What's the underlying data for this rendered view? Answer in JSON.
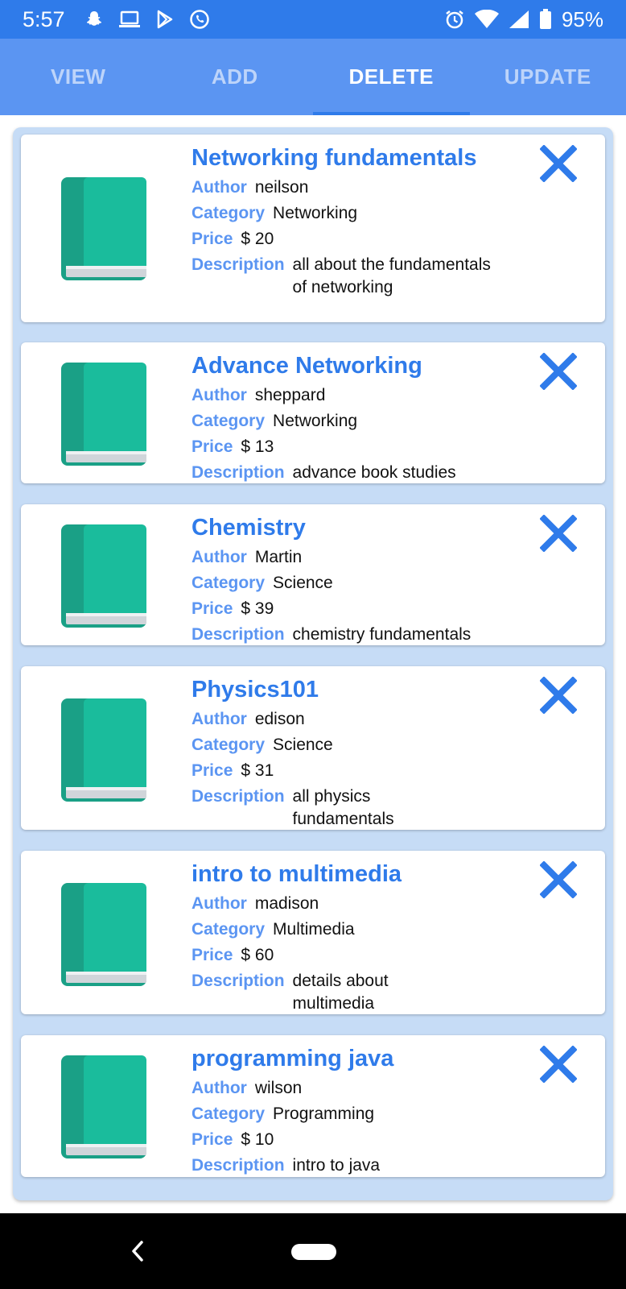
{
  "status_bar": {
    "time": "5:57",
    "battery": "95%",
    "left_icons": [
      "snapchat-icon",
      "laptop-icon",
      "play-store-icon",
      "whatsapp-icon"
    ],
    "right_icons": [
      "alarm-icon",
      "wifi-icon",
      "signal-icon",
      "battery-icon"
    ]
  },
  "tabs": [
    {
      "label": "VIEW",
      "active": false
    },
    {
      "label": "ADD",
      "active": false
    },
    {
      "label": "DELETE",
      "active": true
    },
    {
      "label": "UPDATE",
      "active": false
    }
  ],
  "labels": {
    "author": "Author",
    "category": "Category",
    "price": "Price",
    "description": "Description"
  },
  "books": [
    {
      "title": "Networking fundamentals",
      "author": "neilson",
      "category": "Networking",
      "price": "$ 20",
      "description": "all about the fundamentals of networking"
    },
    {
      "title": "Advance Networking",
      "author": "sheppard",
      "category": "Networking",
      "price": "$ 13",
      "description": "advance book studies"
    },
    {
      "title": "Chemistry",
      "author": "Martin",
      "category": "Science",
      "price": "$ 39",
      "description": "chemistry fundamentals"
    },
    {
      "title": "Physics101",
      "author": "edison",
      "category": "Science",
      "price": "$ 31",
      "description": "all physics fundamentals"
    },
    {
      "title": "intro to multimedia",
      "author": "madison",
      "category": "Multimedia",
      "price": "$ 60",
      "description": "details about multimedia"
    },
    {
      "title": "programming java",
      "author": "wilson",
      "category": "Programming",
      "price": "$ 10",
      "description": "intro to java"
    }
  ],
  "colors": {
    "status_bar": "#2f7bea",
    "tab_bar": "#5b95f2",
    "accent": "#2f7bea",
    "panel": "#c6dcf6",
    "book_cover": "#1abc9c"
  }
}
